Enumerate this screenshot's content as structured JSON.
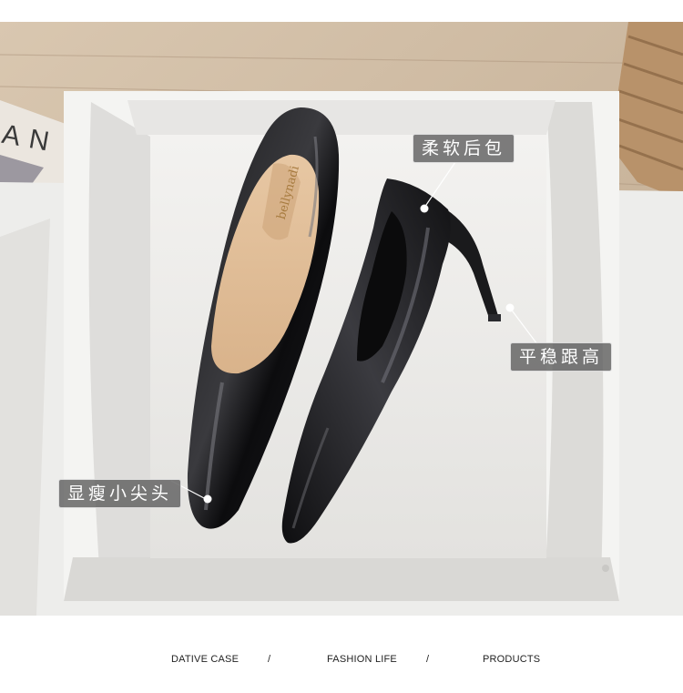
{
  "callouts": {
    "heel_counter": "柔软后包",
    "stable_heel": "平稳跟高",
    "pointed_toe": "显瘦小尖头"
  },
  "box_text": "AN",
  "insole_brand": "bellynadi",
  "footer": {
    "item1": "DATIVE CASE",
    "sep1": "/",
    "item2": "FASHION LIFE",
    "sep2": "/",
    "item3": "PRODUCTS"
  }
}
